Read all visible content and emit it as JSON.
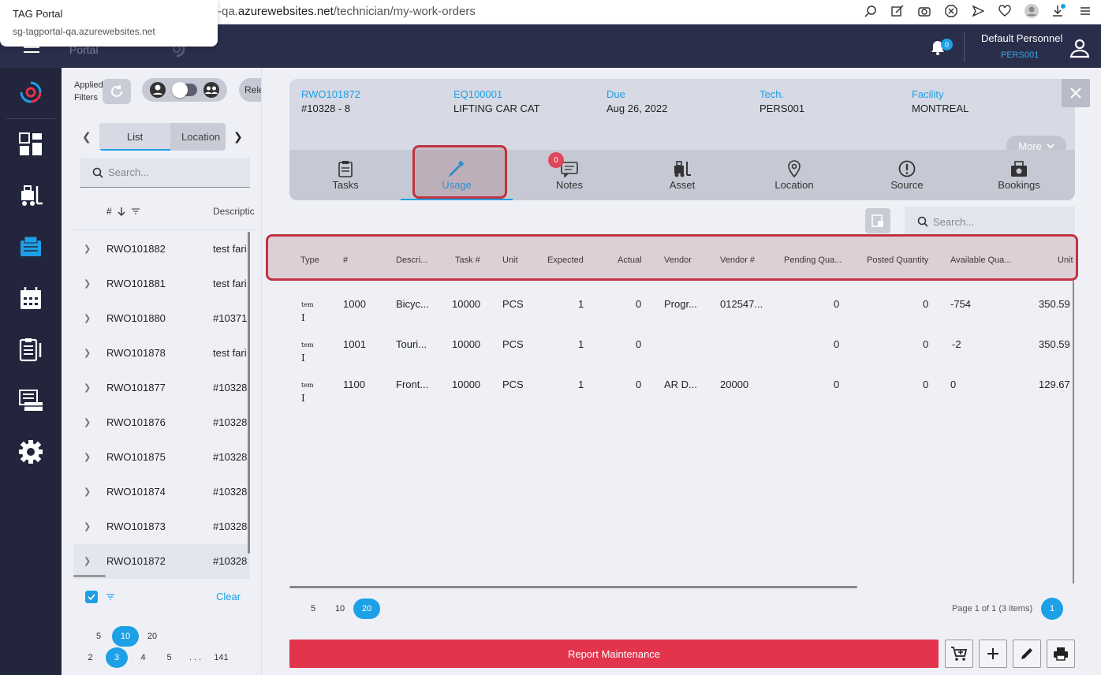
{
  "browser": {
    "url_prefix": "-qa.",
    "url_domain": "azurewebsites.net",
    "url_path": "/technician/my-work-orders",
    "tab_popup_title": "TAG Portal",
    "tab_popup_domain": "sg-tagportal-qa.azurewebsites.net"
  },
  "header": {
    "logo_text": "Portal",
    "notification_count": "0",
    "user_name": "Default Personnel",
    "user_code": "PERS001"
  },
  "list_panel": {
    "applied_filters": "Applied Filters",
    "rele_label": "Rele",
    "tabs": [
      "List",
      "Location"
    ],
    "search_placeholder": "Search...",
    "col_hash": "#",
    "col_desc": "Descriptic",
    "rows": [
      {
        "id": "RWO101882",
        "desc": "test fari"
      },
      {
        "id": "RWO101881",
        "desc": "test fari"
      },
      {
        "id": "RWO101880",
        "desc": "#10371"
      },
      {
        "id": "RWO101878",
        "desc": "test fari"
      },
      {
        "id": "RWO101877",
        "desc": "#10328"
      },
      {
        "id": "RWO101876",
        "desc": "#10328"
      },
      {
        "id": "RWO101875",
        "desc": "#10328"
      },
      {
        "id": "RWO101874",
        "desc": "#10328"
      },
      {
        "id": "RWO101873",
        "desc": "#10328"
      },
      {
        "id": "RWO101872",
        "desc": "#10328"
      }
    ],
    "clear_label": "Clear",
    "page_sizes": [
      "5",
      "10",
      "20"
    ],
    "pages": [
      "2",
      "3",
      "4",
      "5",
      ". . .",
      "141"
    ]
  },
  "work_order": {
    "fields": [
      {
        "label": "RWO101872",
        "value": "#10328 - 8"
      },
      {
        "label": "EQ100001",
        "value": "LIFTING CAR CAT"
      },
      {
        "label": "Due",
        "value": "Aug 26, 2022"
      },
      {
        "label": "Tech.",
        "value": "PERS001"
      },
      {
        "label": "Facility",
        "value": "MONTREAL"
      }
    ],
    "more_label": "More",
    "tabs": [
      "Tasks",
      "Usage",
      "Notes",
      "Asset",
      "Location",
      "Source",
      "Bookings"
    ],
    "notes_count": "0"
  },
  "usage_grid": {
    "search_placeholder": "Search...",
    "columns": [
      "Type",
      "#",
      "Descri...",
      "Task #",
      "Unit",
      "Expected",
      "Actual",
      "Vendor",
      "Vendor #",
      "Pending Qua...",
      "Posted Quantity",
      "Available Qua...",
      "Unit co"
    ],
    "type_label_main": "I",
    "type_label_small": "tem",
    "rows": [
      {
        "num": "1000",
        "desc": "Bicyc...",
        "task": "10000",
        "unit": "PCS",
        "expected": "1",
        "actual": "0",
        "vendor": "Progr...",
        "vendor_num": "012547...",
        "pending": "0",
        "posted": "0",
        "available": "-754",
        "unit_cost": "350.59"
      },
      {
        "num": "1001",
        "desc": "Touri...",
        "task": "10000",
        "unit": "PCS",
        "expected": "1",
        "actual": "0",
        "vendor": "",
        "vendor_num": "",
        "pending": "0",
        "posted": "0",
        "available": "-2",
        "unit_cost": "350.59"
      },
      {
        "num": "1100",
        "desc": "Front...",
        "task": "10000",
        "unit": "PCS",
        "expected": "1",
        "actual": "0",
        "vendor": "AR D...",
        "vendor_num": "20000",
        "pending": "0",
        "posted": "0",
        "available": "0",
        "unit_cost": "129.67"
      }
    ],
    "page_sizes": [
      "5",
      "10",
      "20"
    ],
    "page_info": "Page 1 of 1 (3 items)",
    "current_page": "1"
  },
  "actions": {
    "report_label": "Report Maintenance"
  },
  "colors": {
    "accent": "#1ea0e6",
    "danger": "#e2344d",
    "nav_bg": "#22253c",
    "highlight": "#c0333f"
  }
}
